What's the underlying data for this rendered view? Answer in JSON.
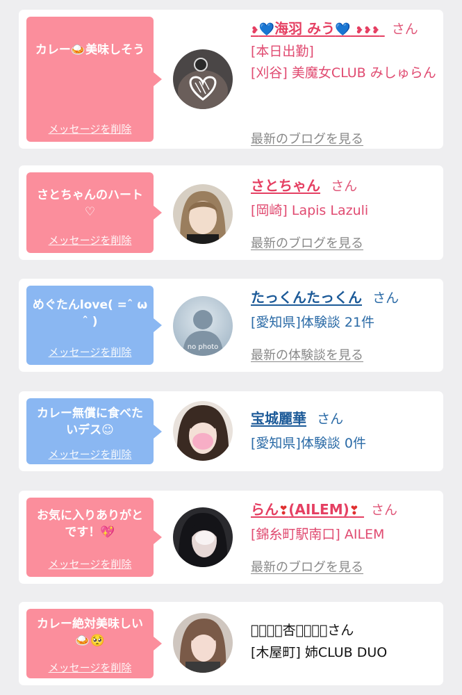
{
  "cards": [
    {
      "message": "カレー🍛美味しそう",
      "delete_label": "メッセージを削除",
      "name_prefix": "❥",
      "name_heart": "💙",
      "name_main": "海羽 みう",
      "name_suffix": "❥❥❥",
      "san": "さん",
      "line1": "[本日出勤]",
      "line2": "[刈谷] 美魔女CLUB みしゅらん",
      "more": "最新のブログを見る"
    },
    {
      "message": "さとちゃんのハート♡",
      "delete_label": "メッセージを削除",
      "name": "さとちゃん",
      "san": "さん",
      "line1": "[岡崎] Lapis Lazuli",
      "more": "最新のブログを見る"
    },
    {
      "message": "めぐたんlove( =ˆ ω ˆ )",
      "delete_label": "メッセージを削除",
      "name": "たっくんたっくん",
      "san": "さん",
      "line1": "[愛知県]体験談 21件",
      "more": "最新の体験談を見る",
      "avatar_text": "no photo"
    },
    {
      "message": "カレー無償に食べたいデス☺",
      "delete_label": "メッセージを削除",
      "name": "宝城麗華",
      "san": "さん",
      "line1": "[愛知県]体験談 0件"
    },
    {
      "message": "お気に入りありがとです！💖",
      "delete_label": "メッセージを削除",
      "name_main": "らん",
      "name_heart": "❣",
      "name_mid": "(AILEM)",
      "san": "さん",
      "line1": "[錦糸町駅南口] AILEM",
      "more": "最新のブログを見る"
    },
    {
      "message": "カレー絶対美味しい🍛🥺",
      "delete_label": "メッセージを削除",
      "name": "ฺ⃝ฺ⃝杏ฺ⃝ฺ⃝さん",
      "line1": "[木屋町] 姉CLUB DUO"
    }
  ],
  "colors": {
    "pink_bubble": "#fb8e9c",
    "blue_bubble": "#8ab7f2",
    "pink_text": "#e53f62",
    "blue_text": "#1c5a98"
  }
}
